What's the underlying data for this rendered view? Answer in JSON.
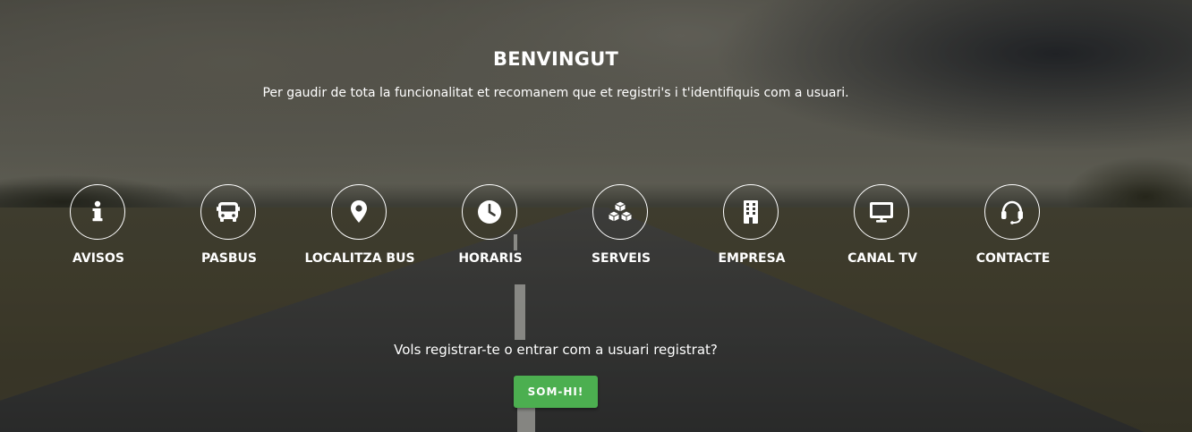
{
  "welcome": {
    "title": "BENVINGUT",
    "subtitle": "Per gaudir de tota la funcionalitat et recomanem que et registri's i t'identifiquis com a usuari."
  },
  "nav": {
    "items": [
      {
        "label": "AVISOS",
        "icon": "info-icon"
      },
      {
        "label": "PASBUS",
        "icon": "bus-icon"
      },
      {
        "label": "LOCALITZA BUS",
        "icon": "map-pin-icon"
      },
      {
        "label": "HORARIS",
        "icon": "clock-icon"
      },
      {
        "label": "SERVEIS",
        "icon": "cubes-icon"
      },
      {
        "label": "EMPRESA",
        "icon": "building-icon"
      },
      {
        "label": "CANAL TV",
        "icon": "tv-icon"
      },
      {
        "label": "CONTACTE",
        "icon": "headset-icon"
      }
    ]
  },
  "register": {
    "question": "Vols registrar-te o entrar com a usuari registrat?",
    "button_label": "SOM-HI!"
  },
  "colors": {
    "accent": "#4caf50",
    "text": "#ffffff"
  }
}
